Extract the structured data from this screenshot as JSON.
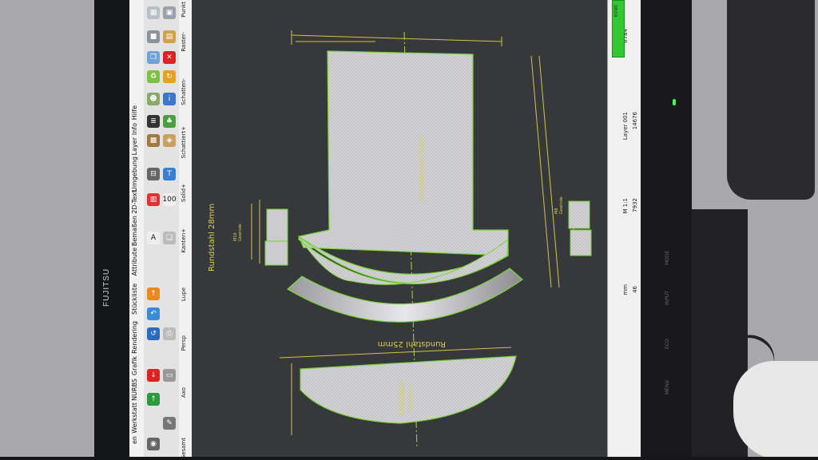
{
  "monitor": {
    "brand": "FUJITSU",
    "buttons": [
      "MENU",
      "ECO",
      "INPUT",
      "MODE"
    ]
  },
  "menu": [
    "en",
    "Werkstatt",
    "NURBS",
    "Grafik",
    "Rendering",
    "Stückliste",
    "Attribute",
    "Bemaßen",
    "2D-Text",
    "Umgebung",
    "Layer",
    "Info",
    "Hilfe"
  ],
  "toolbar": {
    "bottom_labels": [
      "Gesamt",
      "Axo",
      "Persp",
      "Lupe",
      "Kanten+",
      "Solid+",
      "Schattiert+",
      "Schatten-",
      "Raster-",
      "Punkt"
    ]
  },
  "status": {
    "green_value": "6090",
    "mm": "mm",
    "scale": "M 1:1",
    "layer": "Layer 001",
    "x": "46",
    "y": "7932",
    "z": "14676",
    "other": "6784"
  },
  "drawing": {
    "title1": "Rundstahl 28mm",
    "title2": "Rundstahl 25mm",
    "center_label": "Grundkoerper Form",
    "bottom_label1": "Deckblech",
    "bottom_label2": "Flach/mm",
    "thread_labels": [
      "M10",
      "Gewinde",
      "M8",
      "Gewinde"
    ]
  }
}
